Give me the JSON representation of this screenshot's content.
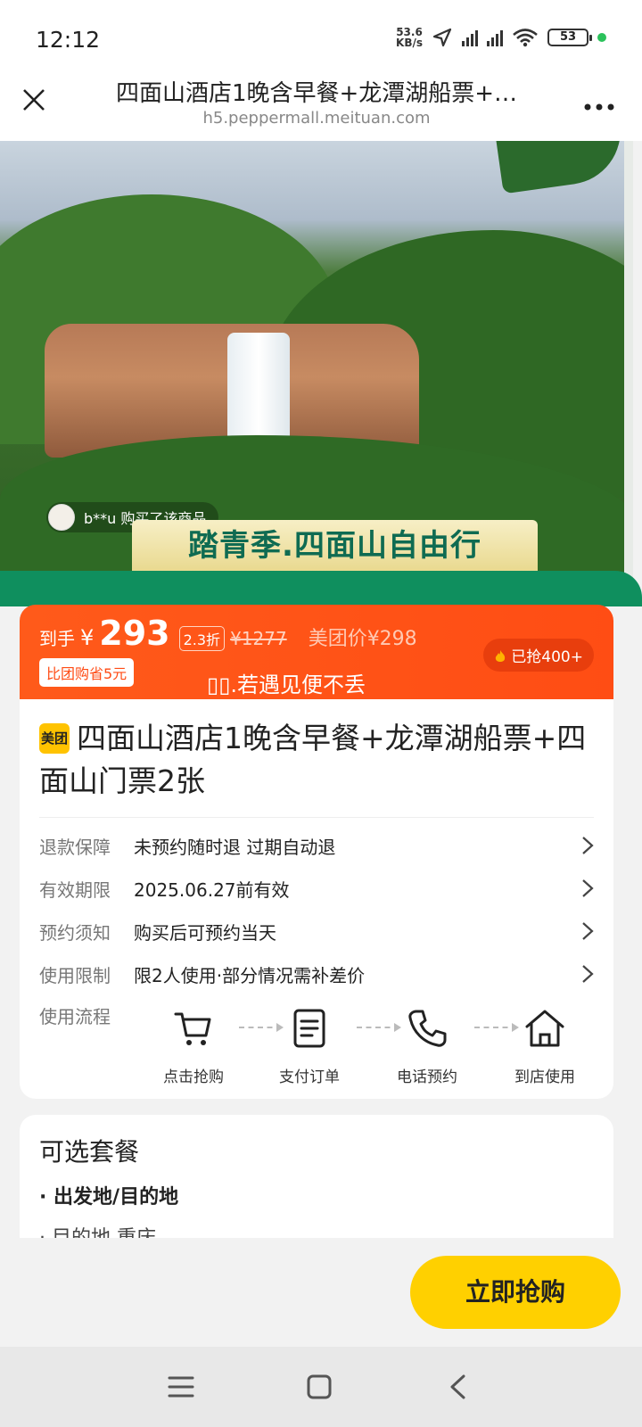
{
  "status_bar": {
    "time": "12:12",
    "net_speed_value": "53.6",
    "net_speed_unit": "KB/s",
    "battery": "53"
  },
  "title_bar": {
    "title": "四面山酒店1晚含早餐+龙潭湖船票+…",
    "url": "h5.peppermall.meituan.com",
    "close_icon": "close-icon",
    "more_icon": "more-dots-icon"
  },
  "hero": {
    "buyer_text": "b**u 购买了该商品",
    "banner_text": "踏青季.四面山自由行"
  },
  "price": {
    "label": "到手",
    "currency": "¥",
    "amount": "293",
    "discount": "2.3折",
    "original": "¥1277",
    "meituan_price": "美团价¥298",
    "save_badge": "比团购省5元",
    "sold": "已抢400+",
    "slogan": "▯▯.若遇见便不丢"
  },
  "product": {
    "tag": "美团",
    "title": "四面山酒店1晚含早餐+龙潭湖船票+四面山门票2张"
  },
  "info_rows": [
    {
      "key": "退款保障",
      "value": "未预约随时退 过期自动退"
    },
    {
      "key": "有效期限",
      "value": "2025.06.27前有效"
    },
    {
      "key": "预约须知",
      "value": "购买后可预约当天"
    },
    {
      "key": "使用限制",
      "value": "限2人使用·部分情况需补差价"
    }
  ],
  "flow": {
    "label": "使用流程",
    "steps": [
      {
        "label": "点击抢购",
        "icon": "cart-icon"
      },
      {
        "label": "支付订单",
        "icon": "order-doc-icon"
      },
      {
        "label": "电话预约",
        "icon": "phone-icon"
      },
      {
        "label": "到店使用",
        "icon": "home-icon"
      }
    ]
  },
  "options": {
    "title": "可选套餐",
    "item": "出发地/目的地",
    "sub": "目的地 重庆"
  },
  "action": {
    "buy_label": "立即抢购"
  },
  "colors": {
    "accent_orange": "#ff4d14",
    "buy_yellow": "#ffd000",
    "banner_green": "#0f6b52"
  }
}
